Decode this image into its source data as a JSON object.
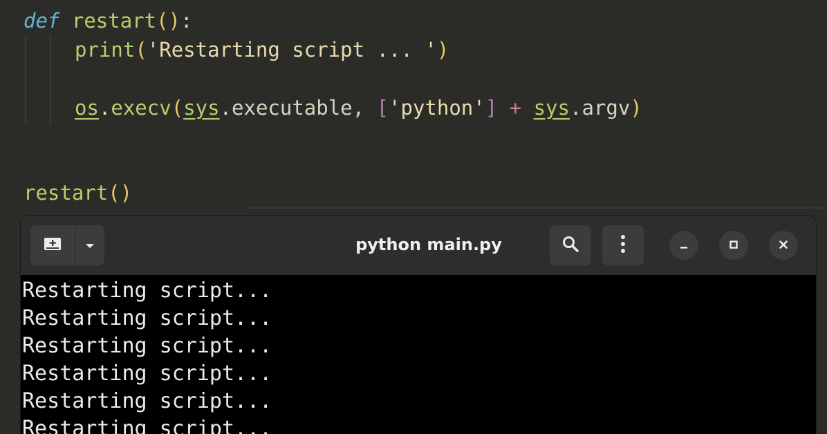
{
  "editor": {
    "line1": {
      "keyword": "def",
      "name": "restart",
      "parens": "()",
      "colon": ":"
    },
    "line2": {
      "func": "print",
      "open": "(",
      "string": "'Restarting script ... '",
      "close": ")"
    },
    "line3": {
      "module": "os",
      "dot1": ".",
      "method": "execv",
      "open": "(",
      "arg_module": "sys",
      "dot2": ".",
      "arg_attr": "executable",
      "comma": ", ",
      "list_open": "[",
      "list_string": "'python'",
      "list_close": "]",
      "plus": " + ",
      "arg2_module": "sys",
      "dot3": ".",
      "arg2_attr": "argv",
      "close": ")"
    },
    "line4": {
      "call": "restart",
      "parens": "()"
    }
  },
  "terminal": {
    "title": "python main.py",
    "output": [
      "Restarting script...",
      "Restarting script...",
      "Restarting script...",
      "Restarting script...",
      "Restarting script...",
      "Restarting script..."
    ]
  },
  "icons": {
    "new_tab": "new-tab-icon",
    "dropdown": "chevron-down-icon",
    "search": "search-icon",
    "menu": "kebab-menu-icon",
    "minimize": "minimize-icon",
    "maximize": "maximize-icon",
    "close": "close-icon"
  },
  "colors": {
    "editor_bg": "#2b2b28",
    "keyword": "#66b3d6",
    "function": "#b9cf6e",
    "terminal_bg": "#000000",
    "titlebar_bg": "#2d2d2d"
  }
}
